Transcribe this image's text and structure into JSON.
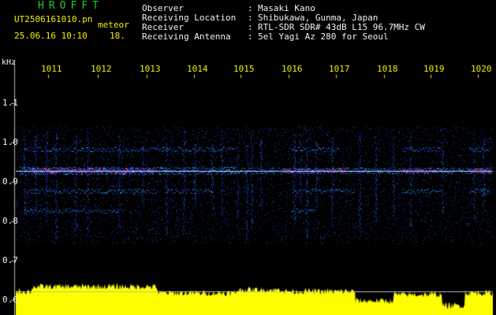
{
  "header": {
    "app_name": "HROFFT",
    "filename": "UT2506161010.pn",
    "meteor_label": "meteor",
    "datetime": "25.06.16 10:10",
    "count": "18.",
    "fields": [
      {
        "label": "Observer",
        "sep": ":",
        "value": "Masaki Kano"
      },
      {
        "label": "Receiving Location",
        "sep": ":",
        "value": "Shibukawa, Gunma, Japan"
      },
      {
        "label": "Receiver",
        "sep": ":",
        "value": "RTL-SDR SDR# 43dB L15 96.7MHz CW"
      },
      {
        "label": "Receiving Antenna",
        "sep": ":",
        "value": "5el Yagi Az 280 for Seoul"
      }
    ]
  },
  "axis": {
    "unit": "kHz",
    "y_ticks": [
      "1.1",
      "1.0",
      "0.9",
      "0.8",
      "0.7",
      "0.6"
    ],
    "x_ticks": [
      "1011",
      "1012",
      "1013",
      "1014",
      "1015",
      "1016",
      "1017",
      "1018",
      "1019",
      "1020"
    ]
  },
  "colors": {
    "background": "#000000",
    "text": "#f2f2f2",
    "accent": "#f0f000",
    "title": "#22cc22",
    "signal_low": "#1030a0",
    "signal_mid": "#00e0e0",
    "signal_high": "#ff2080",
    "carrier": "#d0d0ff"
  }
}
